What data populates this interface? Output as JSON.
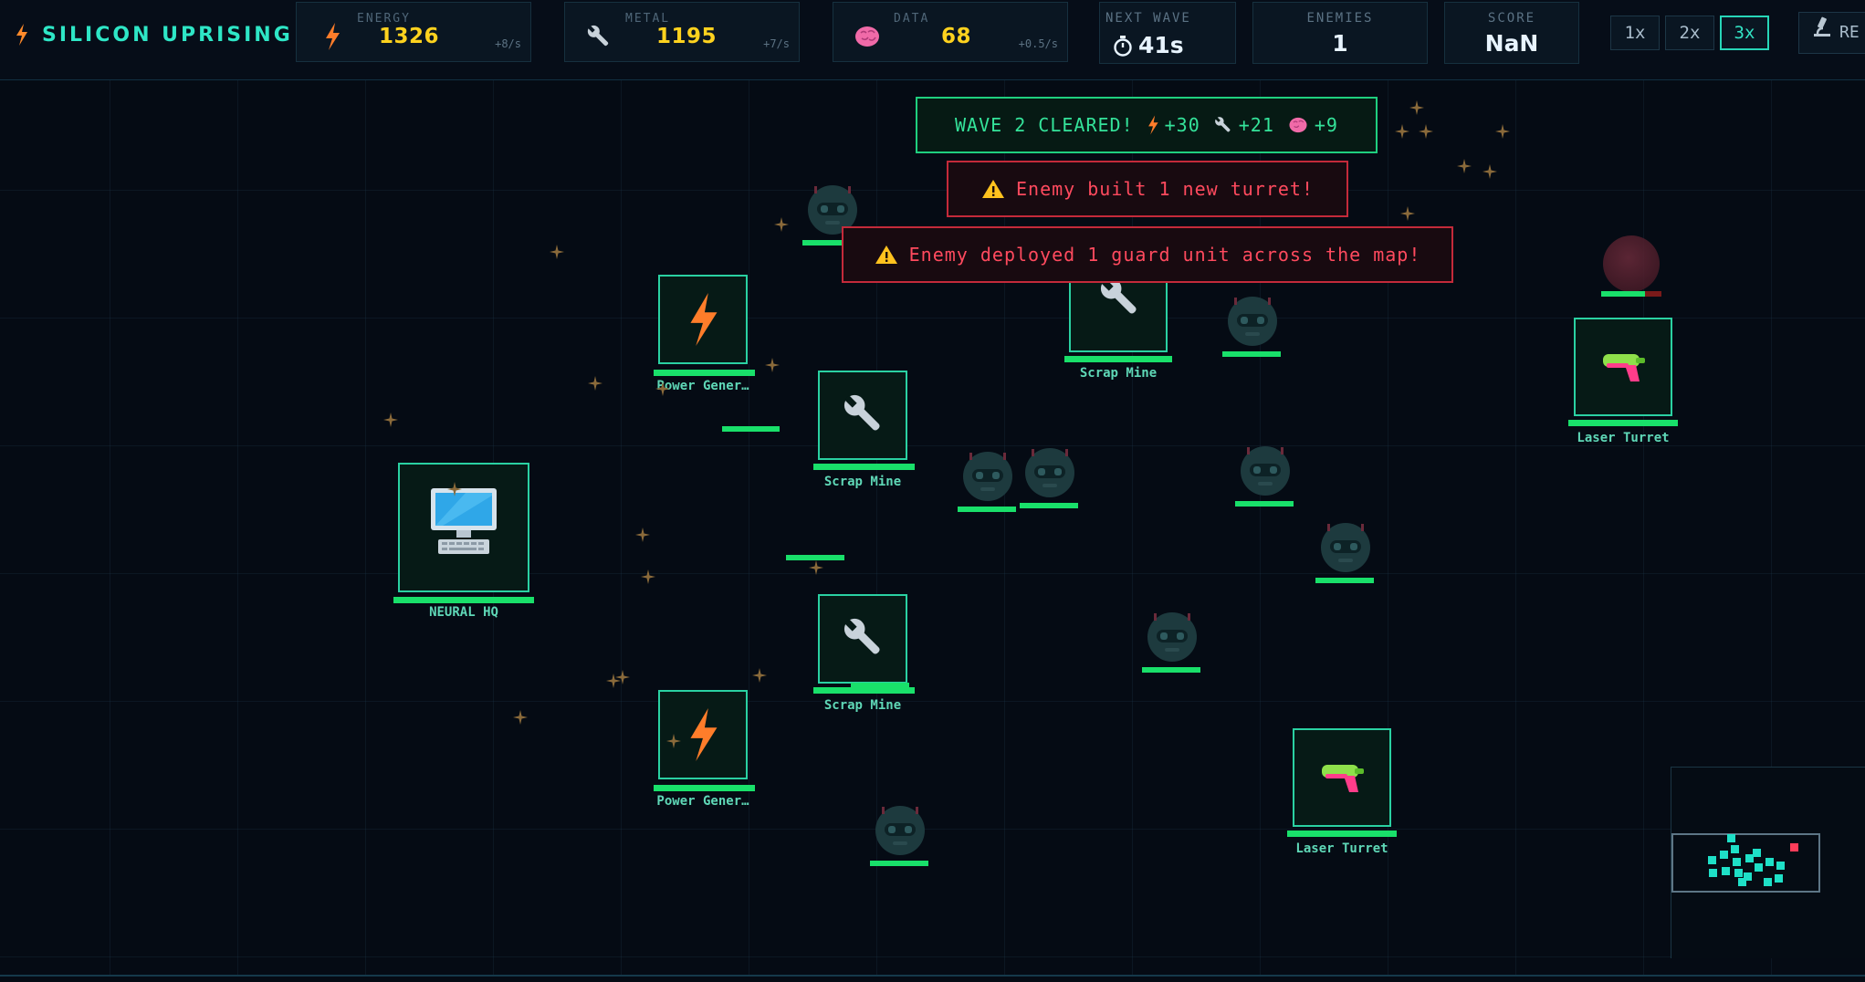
{
  "game": {
    "title": "SILICON UPRISING"
  },
  "resources": {
    "energy": {
      "label": "ENERGY",
      "value": "1326",
      "rate": "+8/s",
      "icon": "lightning-icon",
      "color": "#ffd21e"
    },
    "metal": {
      "label": "METAL",
      "value": "1195",
      "rate": "+7/s",
      "icon": "wrench-icon",
      "color": "#ffd21e"
    },
    "data": {
      "label": "DATA",
      "value": "68",
      "rate": "+0.5/s",
      "icon": "brain-icon",
      "color": "#ffd21e"
    }
  },
  "stats": {
    "next_wave": {
      "label": "NEXT WAVE",
      "value": "41s",
      "icon": "stopwatch-icon"
    },
    "enemies": {
      "label": "ENEMIES",
      "value": "1"
    },
    "score": {
      "label": "SCORE",
      "value": "NaN"
    }
  },
  "speed": {
    "options": [
      "1x",
      "2x",
      "3x"
    ],
    "selected": "3x"
  },
  "research": {
    "label": "RE",
    "icon": "microscope-icon"
  },
  "notifications": {
    "wave_cleared": {
      "text": "WAVE 2 CLEARED!",
      "energy": "+30",
      "metal": "+21",
      "data": "+9"
    },
    "turret": "Enemy built 1 new turret!",
    "guard": "Enemy deployed 1 guard unit across the map!"
  },
  "buildings": {
    "hq": {
      "label": "NEURAL HQ",
      "icon": "computer-icon"
    },
    "power1": {
      "label": "Power Gener…",
      "icon": "lightning-icon"
    },
    "power2": {
      "label": "Power Gener…",
      "icon": "lightning-icon"
    },
    "mine1": {
      "label": "Scrap Mine",
      "icon": "wrench-icon"
    },
    "mine2": {
      "label": "Scrap Mine",
      "icon": "wrench-icon"
    },
    "mine3": {
      "label": "Scrap Mine",
      "icon": "wrench-icon"
    },
    "turret1": {
      "label": "Laser Turret",
      "icon": "laser-gun-icon"
    },
    "turret2": {
      "label": "Laser Turret",
      "icon": "laser-gun-icon"
    }
  },
  "colors": {
    "accent": "#2ee6c6",
    "building_border": "#2ad1a2",
    "health": "#19e06a",
    "warning": "#ff4a5e",
    "success": "#34e39a"
  }
}
